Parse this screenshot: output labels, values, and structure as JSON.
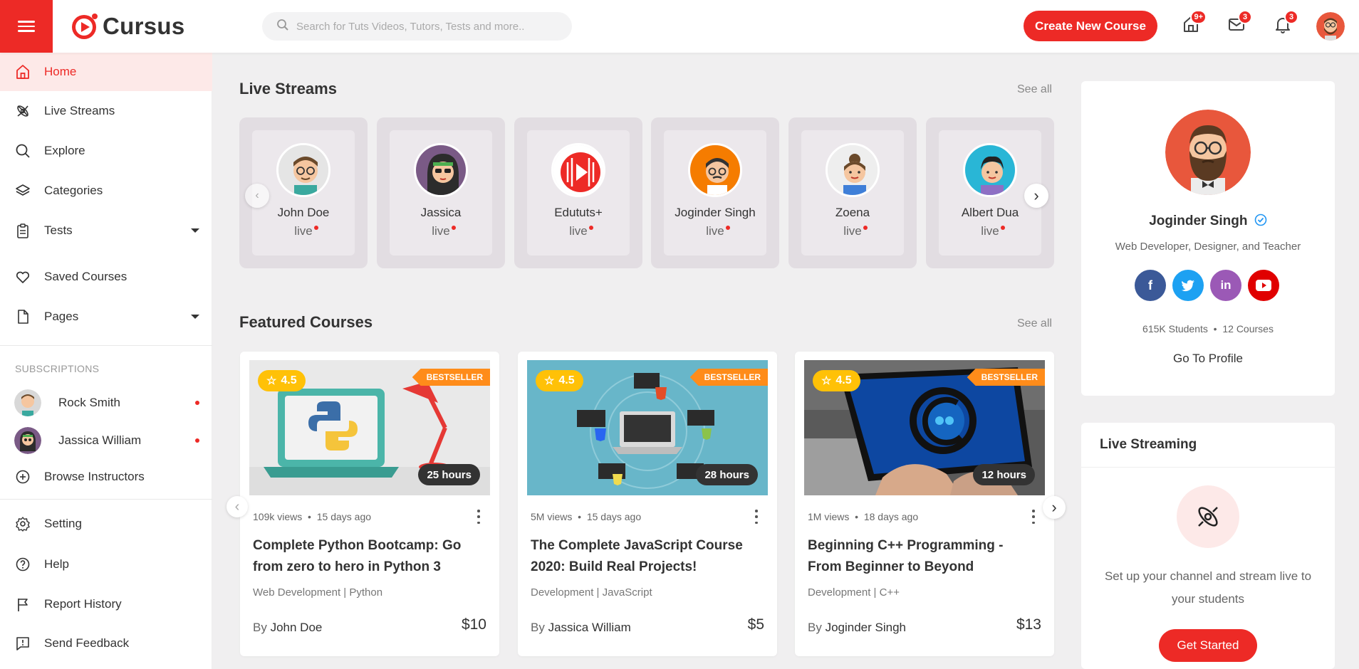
{
  "brand": {
    "name": "Cursus",
    "accent": "#ed2a26"
  },
  "header": {
    "search_placeholder": "Search for Tuts Videos, Tutors, Tests and more..",
    "create_label": "Create New Course",
    "badges": {
      "home": "9+",
      "mail": "3",
      "bell": "3"
    }
  },
  "sidebar": {
    "items": [
      {
        "label": "Home",
        "icon": "home-icon"
      },
      {
        "label": "Live Streams",
        "icon": "live-icon"
      },
      {
        "label": "Explore",
        "icon": "search-icon"
      },
      {
        "label": "Categories",
        "icon": "layers-icon"
      },
      {
        "label": "Tests",
        "icon": "clipboard-icon"
      },
      {
        "label": "Saved Courses",
        "icon": "heart-icon"
      },
      {
        "label": "Pages",
        "icon": "file-icon"
      }
    ],
    "subscriptions_title": "SUBSCRIPTIONS",
    "subscriptions": [
      {
        "name": "Rock Smith"
      },
      {
        "name": "Jassica William"
      }
    ],
    "browse": "Browse Instructors",
    "bottom": [
      {
        "label": "Setting",
        "icon": "gear-icon"
      },
      {
        "label": "Help",
        "icon": "help-icon"
      },
      {
        "label": "Report History",
        "icon": "flag-icon"
      },
      {
        "label": "Send Feedback",
        "icon": "feedback-icon"
      }
    ]
  },
  "live_streams": {
    "title": "Live Streams",
    "see_all": "See all",
    "live_label": "live",
    "items": [
      {
        "name": "John Doe"
      },
      {
        "name": "Jassica"
      },
      {
        "name": "Edututs+"
      },
      {
        "name": "Joginder Singh"
      },
      {
        "name": "Zoena"
      },
      {
        "name": "Albert Dua"
      }
    ]
  },
  "featured": {
    "title": "Featured Courses",
    "see_all": "See all",
    "by_label": "By",
    "courses": [
      {
        "rating": "4.5",
        "badge": "BESTSELLER",
        "hours": "25 hours",
        "views": "109k views",
        "ago": "15 days ago",
        "title": "Complete Python Bootcamp: Go from zero to hero in Python 3",
        "category": "Web Development | Python",
        "author": "John Doe",
        "price": "$10"
      },
      {
        "rating": "4.5",
        "badge": "BESTSELLER",
        "hours": "28 hours",
        "views": "5M views",
        "ago": "15 days ago",
        "title": "The Complete JavaScript Course 2020: Build Real Projects!",
        "category": "Development | JavaScript",
        "author": "Jassica William",
        "price": "$5"
      },
      {
        "rating": "4.5",
        "badge": "BESTSELLER",
        "hours": "12 hours",
        "views": "1M views",
        "ago": "18 days ago",
        "title": "Beginning C++ Programming - From Beginner to Beyond",
        "category": "Development | C++",
        "author": "Joginder Singh",
        "price": "$13"
      }
    ]
  },
  "profile": {
    "name": "Joginder Singh",
    "role": "Web Developer, Designer, and Teacher",
    "students": "615K Students",
    "courses": "12 Courses",
    "link": "Go To Profile",
    "socials": [
      "facebook-icon",
      "twitter-icon",
      "linkedin-icon",
      "youtube-icon"
    ]
  },
  "live_streaming": {
    "title": "Live Streaming",
    "text": "Set up your channel and stream live to your students",
    "button": "Get Started"
  }
}
